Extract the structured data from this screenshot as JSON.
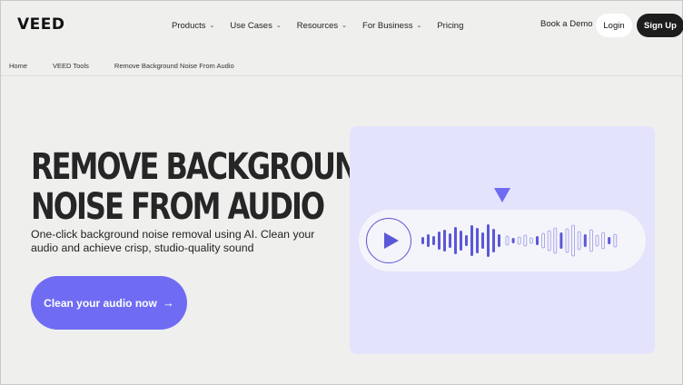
{
  "nav": {
    "logo": "VEED",
    "menu": [
      {
        "label": "Products",
        "chevron": true
      },
      {
        "label": "Use Cases",
        "chevron": true
      },
      {
        "label": "Resources",
        "chevron": true
      },
      {
        "label": "For Business",
        "chevron": true
      },
      {
        "label": "Pricing",
        "chevron": false
      }
    ],
    "book_demo": "Book a Demo",
    "login": "Login",
    "signup": "Sign Up"
  },
  "breadcrumb": [
    "Home",
    "VEED Tools",
    "Remove Background Noise From Audio"
  ],
  "hero": {
    "title_line1": "REMOVE BACKGROUND",
    "title_line2": "NOISE FROM AUDIO",
    "description": "One-click background noise removal using AI. Clean your audio and achieve crisp, studio-quality sound",
    "cta_label": "Clean your audio now",
    "cta_arrow": "→"
  },
  "colors": {
    "accent": "#6f6cf3",
    "wave_solid": "#5b58d6",
    "panel": "#e3e4fb"
  },
  "icons": {
    "play": "play-icon",
    "marker": "triangle-down-icon",
    "chevron": "chevron-down-icon"
  }
}
